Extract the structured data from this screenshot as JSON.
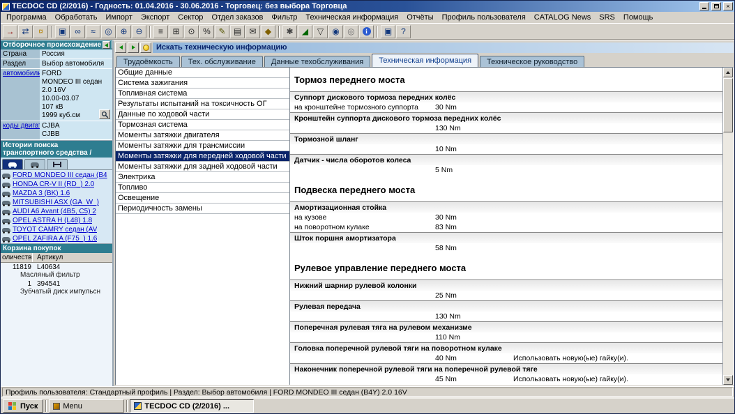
{
  "window": {
    "title": "TECDOC CD (2/2016)  -  Годность: 01.04.2016 - 30.06.2016  -  Торговец: без выбора Торговца"
  },
  "menu": {
    "items": [
      "Программа",
      "Обработать",
      "Импорт",
      "Экспорт",
      "Сектор",
      "Отдел заказов",
      "Фильтр",
      "Техническая информация",
      "Отчёты",
      "Профиль пользователя",
      "CATALOG News",
      "SRS",
      "Помощь"
    ]
  },
  "toolbar": {
    "groups": [
      [
        {
          "name": "exit-icon",
          "glyph": "→",
          "color": "#8b0000"
        },
        {
          "name": "transfer-icon",
          "glyph": "⇄",
          "color": "#12387c"
        },
        {
          "name": "power-icon",
          "glyph": "¤",
          "color": "#b8860b"
        }
      ],
      [
        {
          "name": "workstation-icon",
          "glyph": "▣",
          "color": "#12387c"
        },
        {
          "name": "connection-icon",
          "glyph": "∞",
          "color": "#12387c"
        },
        {
          "name": "network-icon",
          "glyph": "≈",
          "color": "#12387c"
        },
        {
          "name": "screen-search-icon",
          "glyph": "◎",
          "color": "#12387c"
        },
        {
          "name": "zoom-in-icon",
          "glyph": "⊕",
          "color": "#12387c"
        },
        {
          "name": "zoom-out-icon",
          "glyph": "⊖",
          "color": "#12387c"
        }
      ],
      [
        {
          "name": "list-icon",
          "glyph": "≡",
          "color": "#222222"
        },
        {
          "name": "table-icon",
          "glyph": "⊞",
          "color": "#222222"
        },
        {
          "name": "time-icon",
          "glyph": "⊙",
          "color": "#222222"
        },
        {
          "name": "percent-icon",
          "glyph": "%",
          "color": "#222222"
        },
        {
          "name": "edit-icon",
          "glyph": "✎",
          "color": "#555500"
        },
        {
          "name": "catalog-icon",
          "glyph": "▤",
          "color": "#222222"
        },
        {
          "name": "mail-icon",
          "glyph": "✉",
          "color": "#222222"
        },
        {
          "name": "parts-icon",
          "glyph": "◆",
          "color": "#806000"
        }
      ],
      [
        {
          "name": "tools-icon",
          "glyph": "✱",
          "color": "#444444"
        },
        {
          "name": "chart-icon",
          "glyph": "◢",
          "color": "#006600"
        },
        {
          "name": "filter-icon",
          "glyph": "▽",
          "color": "#222222"
        },
        {
          "name": "globe-icon",
          "glyph": "◉",
          "color": "#12387c"
        },
        {
          "name": "cd-icon",
          "glyph": "◎",
          "color": "#707070"
        },
        {
          "name": "info-icon",
          "glyph": "i",
          "color": "#ffffff",
          "bg": "#2a5ad0"
        }
      ],
      [
        {
          "name": "monitor-icon",
          "glyph": "▣",
          "color": "#12387c"
        },
        {
          "name": "help-icon",
          "glyph": "?",
          "color": "#12387c"
        }
      ]
    ]
  },
  "sidebar": {
    "selection_header": "Отборочное происхождение",
    "country_label": "Страна",
    "country_value": "Россия",
    "section_label": "Раздел",
    "section_value": "Выбор автомобиля",
    "vehicle_label": "автомобиль",
    "vehicle_lines": [
      "FORD",
      "MONDEO III седан",
      "2.0 16V",
      "10.00-03.07",
      "107 кВ",
      "1999 куб.см"
    ],
    "engine_label": "коды двигателя",
    "engine_codes": [
      "CJBA",
      "CJBB"
    ],
    "history_header_line1": "Истории поиска",
    "history_header_line2": "транспортного средства /",
    "history_items": [
      "FORD MONDEO III седан (B4",
      "HONDA CR-V II (RD_) 2.0",
      "MAZDA 3 (BK) 1.6",
      "MITSUBISHI ASX (GA_W_)",
      "AUDI A6 Avant (4B5, C5) 2",
      "OPEL ASTRA H (L48) 1.8",
      "TOYOT CAMRY седан (AV",
      "OPEL ZAFIRA A (F75_) 1.6"
    ],
    "cart_header": "Корзина покупок",
    "cart_col_qty": "оличество",
    "cart_col_art": "Артикул",
    "cart_rows": [
      {
        "qty": "11819",
        "art": "L40634",
        "desc": "Масляный фильтр"
      },
      {
        "qty": "1",
        "art": "394541",
        "desc": "Зубчатый диск импульсн"
      }
    ]
  },
  "main": {
    "panel_title": "Искать техническую информацию",
    "tabs": [
      {
        "label": "Трудоёмкость",
        "active": false
      },
      {
        "label": "Тех. обслуживание",
        "active": false
      },
      {
        "label": "Данные техобслуживания",
        "active": false
      },
      {
        "label": "Техническая информация",
        "active": true
      },
      {
        "label": "Техническое руководство",
        "active": false
      }
    ],
    "categories": [
      {
        "label": "Общие данные",
        "selected": false
      },
      {
        "label": "Система зажигания",
        "selected": false
      },
      {
        "label": "Топливная система",
        "selected": false
      },
      {
        "label": "Результаты испытаний на токсичность ОГ",
        "selected": false
      },
      {
        "label": "Данные по ходовой части",
        "selected": false
      },
      {
        "label": "Тормозная система",
        "selected": false
      },
      {
        "label": "Моменты затяжки двигателя",
        "selected": false
      },
      {
        "label": "Моменты затяжки для трансмиссии",
        "selected": false
      },
      {
        "label": "Моменты затяжки для передней ходовой части",
        "selected": true
      },
      {
        "label": "Моменты затяжки для задней ходовой части",
        "selected": false
      },
      {
        "label": "Электрика",
        "selected": false
      },
      {
        "label": "Топливо",
        "selected": false
      },
      {
        "label": "Освещение",
        "selected": false
      },
      {
        "label": "Периодичность замены",
        "selected": false
      }
    ],
    "sections": [
      {
        "heading": "Тормоз переднего моста",
        "items": [
          {
            "label": "Суппорт дискового тормоза передних колёс",
            "rows": [
              {
                "sub": "на кронштейне тормозного суппорта",
                "value": "30 Nm",
                "note": ""
              }
            ]
          },
          {
            "label": "Кронштейн суппорта дискового тормоза передних колёс",
            "rows": [
              {
                "sub": "",
                "value": "130 Nm",
                "note": ""
              }
            ]
          },
          {
            "label": "Тормозной шланг",
            "rows": [
              {
                "sub": "",
                "value": "10 Nm",
                "note": ""
              }
            ]
          },
          {
            "label": "Датчик - числа оборотов колеса",
            "rows": [
              {
                "sub": "",
                "value": "5 Nm",
                "note": ""
              }
            ]
          }
        ]
      },
      {
        "heading": "Подвеска переднего моста",
        "items": [
          {
            "label": "Амортизационная стойка",
            "rows": [
              {
                "sub": "на кузове",
                "value": "30 Nm",
                "note": ""
              },
              {
                "sub": "на поворотном кулаке",
                "value": "83 Nm",
                "note": ""
              }
            ]
          },
          {
            "label": "Шток поршня амортизатора",
            "rows": [
              {
                "sub": "",
                "value": "58 Nm",
                "note": ""
              }
            ]
          }
        ]
      },
      {
        "heading": "Рулевое управление переднего моста",
        "items": [
          {
            "label": "Нижний шарнир рулевой колонки",
            "rows": [
              {
                "sub": "",
                "value": "25 Nm",
                "note": ""
              }
            ]
          },
          {
            "label": "Рулевая передача",
            "rows": [
              {
                "sub": "",
                "value": "130 Nm",
                "note": ""
              }
            ]
          },
          {
            "label": "Поперечная рулевая тяга на рулевом механизме",
            "rows": [
              {
                "sub": "",
                "value": "110 Nm",
                "note": ""
              }
            ]
          },
          {
            "label": "Головка поперечной рулевой тяги на поворотном кулаке",
            "rows": [
              {
                "sub": "",
                "value": "40 Nm",
                "note": "Использовать новую(ые) гайку(и)."
              }
            ]
          },
          {
            "label": "Наконечник поперечной рулевой тяги на поперечной рулевой тяге",
            "rows": [
              {
                "sub": "",
                "value": "45 Nm",
                "note": "Использовать новую(ые) гайку(и)."
              }
            ]
          }
        ]
      }
    ]
  },
  "statusbar": {
    "text": "Профиль пользователя: Стандартный профиль | Раздел: Выбор автомобиля | FORD MONDEO III седан (B4Y) 2.0 16V"
  },
  "taskbar": {
    "start_label": "Пуск",
    "menu_label": "Menu",
    "task_label": "TECDOC CD (2/2016)  ..."
  }
}
